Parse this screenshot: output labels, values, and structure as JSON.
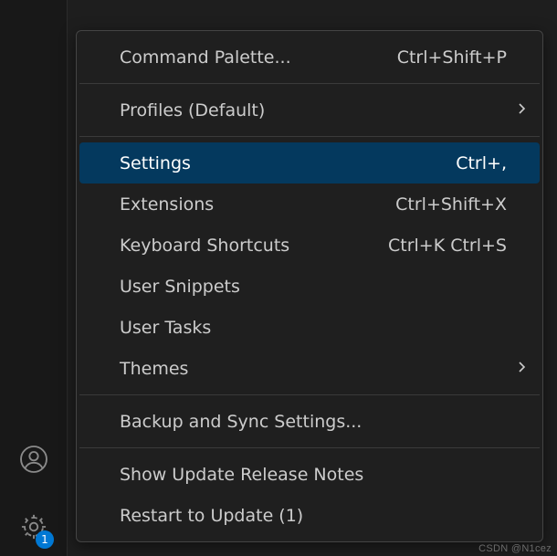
{
  "activity_bar": {
    "account_icon": "account",
    "gear_icon": "gear",
    "gear_badge": "1"
  },
  "menu": {
    "groups": [
      {
        "items": [
          {
            "label": "Command Palette...",
            "shortcut": "Ctrl+Shift+P",
            "submenu": false,
            "highlighted": false
          }
        ]
      },
      {
        "items": [
          {
            "label": "Profiles (Default)",
            "shortcut": "",
            "submenu": true,
            "highlighted": false
          }
        ]
      },
      {
        "items": [
          {
            "label": "Settings",
            "shortcut": "Ctrl+,",
            "submenu": false,
            "highlighted": true
          },
          {
            "label": "Extensions",
            "shortcut": "Ctrl+Shift+X",
            "submenu": false,
            "highlighted": false
          },
          {
            "label": "Keyboard Shortcuts",
            "shortcut": "Ctrl+K Ctrl+S",
            "submenu": false,
            "highlighted": false
          },
          {
            "label": "User Snippets",
            "shortcut": "",
            "submenu": false,
            "highlighted": false
          },
          {
            "label": "User Tasks",
            "shortcut": "",
            "submenu": false,
            "highlighted": false
          },
          {
            "label": "Themes",
            "shortcut": "",
            "submenu": true,
            "highlighted": false
          }
        ]
      },
      {
        "items": [
          {
            "label": "Backup and Sync Settings...",
            "shortcut": "",
            "submenu": false,
            "highlighted": false
          }
        ]
      },
      {
        "items": [
          {
            "label": "Show Update Release Notes",
            "shortcut": "",
            "submenu": false,
            "highlighted": false
          },
          {
            "label": "Restart to Update (1)",
            "shortcut": "",
            "submenu": false,
            "highlighted": false
          }
        ]
      }
    ]
  },
  "watermark": "CSDN @N1cez"
}
